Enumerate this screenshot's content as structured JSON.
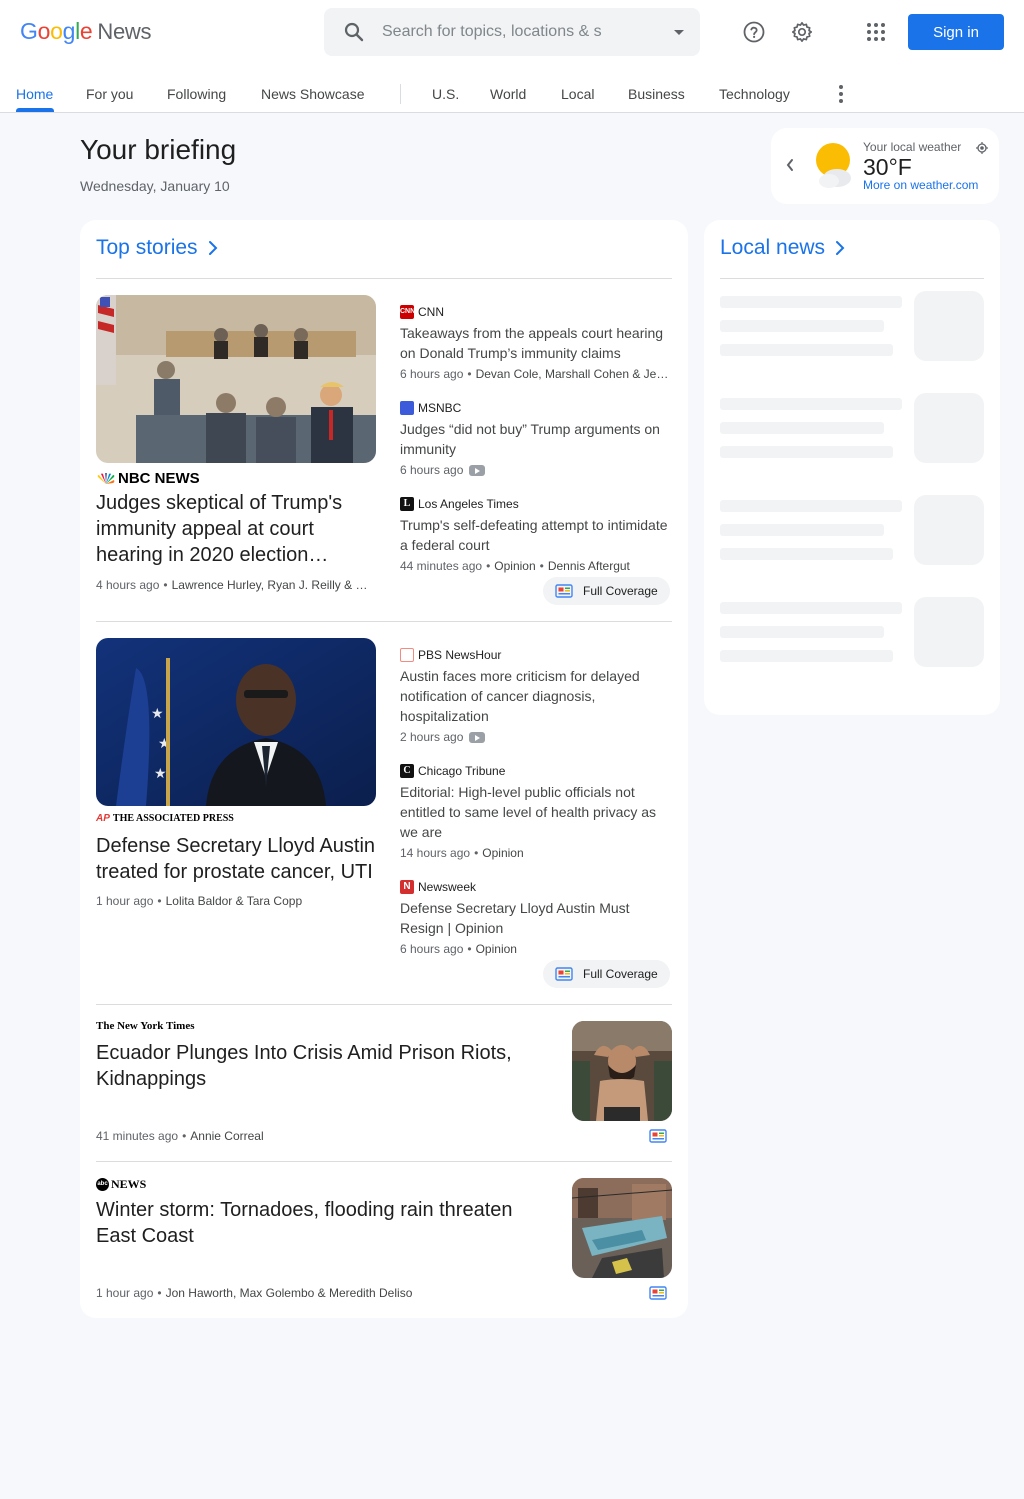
{
  "header": {
    "logo_news": "News",
    "search_placeholder": "Search for topics, locations & s",
    "signin_label": "Sign in"
  },
  "nav": {
    "items": [
      "Home",
      "For you",
      "Following",
      "News Showcase",
      "U.S.",
      "World",
      "Local",
      "Business",
      "Technology"
    ]
  },
  "briefing": {
    "title": "Your briefing",
    "date": "Wednesday, January 10"
  },
  "weather": {
    "label": "Your local weather",
    "temp": "30°F",
    "link": "More on weather.com"
  },
  "top_stories": {
    "heading": "Top stories",
    "cluster1": {
      "main": {
        "source": "NBC NEWS",
        "headline": "Judges skeptical of Trump's immunity appeal at court hearing in 2020 election…",
        "time": "4 hours ago",
        "authors": "Lawrence Hurley, Ryan J. Reilly & …"
      },
      "related": [
        {
          "source": "CNN",
          "headline": "Takeaways from the appeals court hearing on Donald Trump’s immunity claims",
          "time": "6 hours ago",
          "authors": "Devan Cole, Marshall Cohen & Je…"
        },
        {
          "source": "MSNBC",
          "headline": "Judges “did not buy” Trump arguments on immunity",
          "time": "6 hours ago"
        },
        {
          "source": "Los Angeles Times",
          "headline": "Trump's self-defeating attempt to intimidate a federal court",
          "time": "44 minutes ago",
          "tag": "Opinion",
          "authors": "Dennis Aftergut"
        }
      ],
      "full_coverage": "Full Coverage"
    },
    "cluster2": {
      "main": {
        "source": "THE ASSOCIATED PRESS",
        "source_prefix": "AP",
        "headline": "Defense Secretary Lloyd Austin treated for prostate cancer, UTI",
        "time": "1 hour ago",
        "authors": "Lolita Baldor & Tara Copp"
      },
      "related": [
        {
          "source": "PBS NewsHour",
          "headline": "Austin faces more criticism for delayed notification of cancer diagnosis, hospitalization",
          "time": "2 hours ago"
        },
        {
          "source": "Chicago Tribune",
          "headline": "Editorial: High-level public officials not entitled to same level of health privacy as we are",
          "time": "14 hours ago",
          "tag": "Opinion"
        },
        {
          "source": "Newsweek",
          "headline": "Defense Secretary Lloyd Austin Must Resign | Opinion",
          "time": "6 hours ago",
          "tag": "Opinion"
        }
      ],
      "full_coverage": "Full Coverage"
    },
    "story3": {
      "source": "The New York Times",
      "headline": "Ecuador Plunges Into Crisis Amid Prison Riots, Kidnappings",
      "time": "41 minutes ago",
      "authors": "Annie Correal"
    },
    "story4": {
      "source": "NEWS",
      "source_prefix": "abc",
      "headline": "Winter storm: Tornadoes, flooding rain threaten East Coast",
      "time": "1 hour ago",
      "authors": "Jon Haworth, Max Golembo & Meredith Deliso"
    }
  },
  "local_news": {
    "heading": "Local news"
  },
  "colors": {
    "accent": "#1a73e8",
    "page_bg": "#f6f8fc"
  }
}
